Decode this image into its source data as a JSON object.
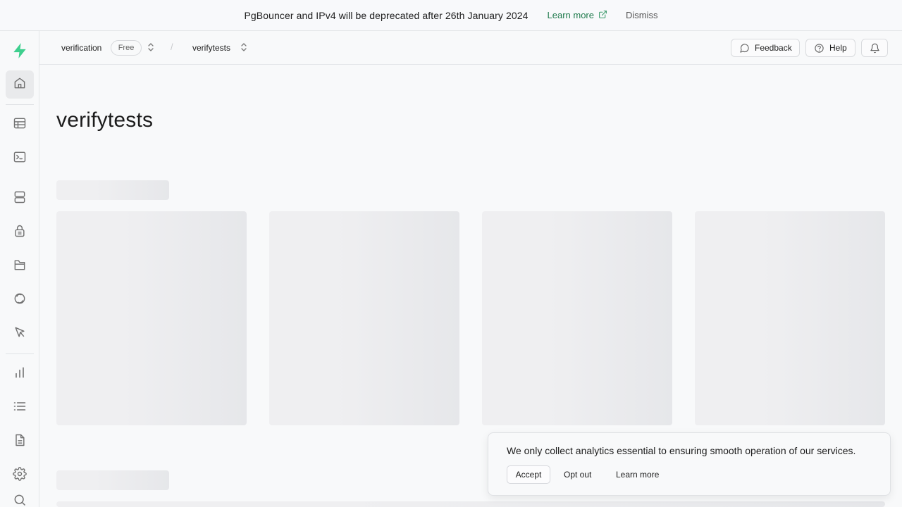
{
  "banner": {
    "message": "PgBouncer and IPv4 will be deprecated after 26th January 2024",
    "learn_more": "Learn more",
    "dismiss": "Dismiss",
    "link_color": "#1f7a4c"
  },
  "sidebar": {
    "brand_color": "#3ecf8e",
    "items": [
      {
        "name": "home",
        "icon": "home-icon",
        "active": true
      },
      {
        "name": "table-editor",
        "icon": "table-icon"
      },
      {
        "name": "sql-editor",
        "icon": "terminal-icon"
      },
      {
        "name": "database",
        "icon": "database-icon"
      },
      {
        "name": "authentication",
        "icon": "lock-icon"
      },
      {
        "name": "storage",
        "icon": "archive-icon"
      },
      {
        "name": "realtime",
        "icon": "realtime-icon"
      },
      {
        "name": "edge-functions",
        "icon": "cursor-icon"
      },
      {
        "name": "reports",
        "icon": "bar-chart-icon"
      },
      {
        "name": "logs",
        "icon": "list-icon"
      },
      {
        "name": "api-docs",
        "icon": "document-icon"
      },
      {
        "name": "settings",
        "icon": "gear-icon"
      },
      {
        "name": "search",
        "icon": "search-icon"
      }
    ]
  },
  "header": {
    "org": "verification",
    "plan_badge": "Free",
    "project": "verifytests",
    "separator": "/",
    "feedback": "Feedback",
    "help": "Help"
  },
  "main": {
    "title": "verifytests"
  },
  "cookie": {
    "message": "We only collect analytics essential to ensuring smooth operation of our services.",
    "accept": "Accept",
    "opt_out": "Opt out",
    "learn_more": "Learn more"
  }
}
